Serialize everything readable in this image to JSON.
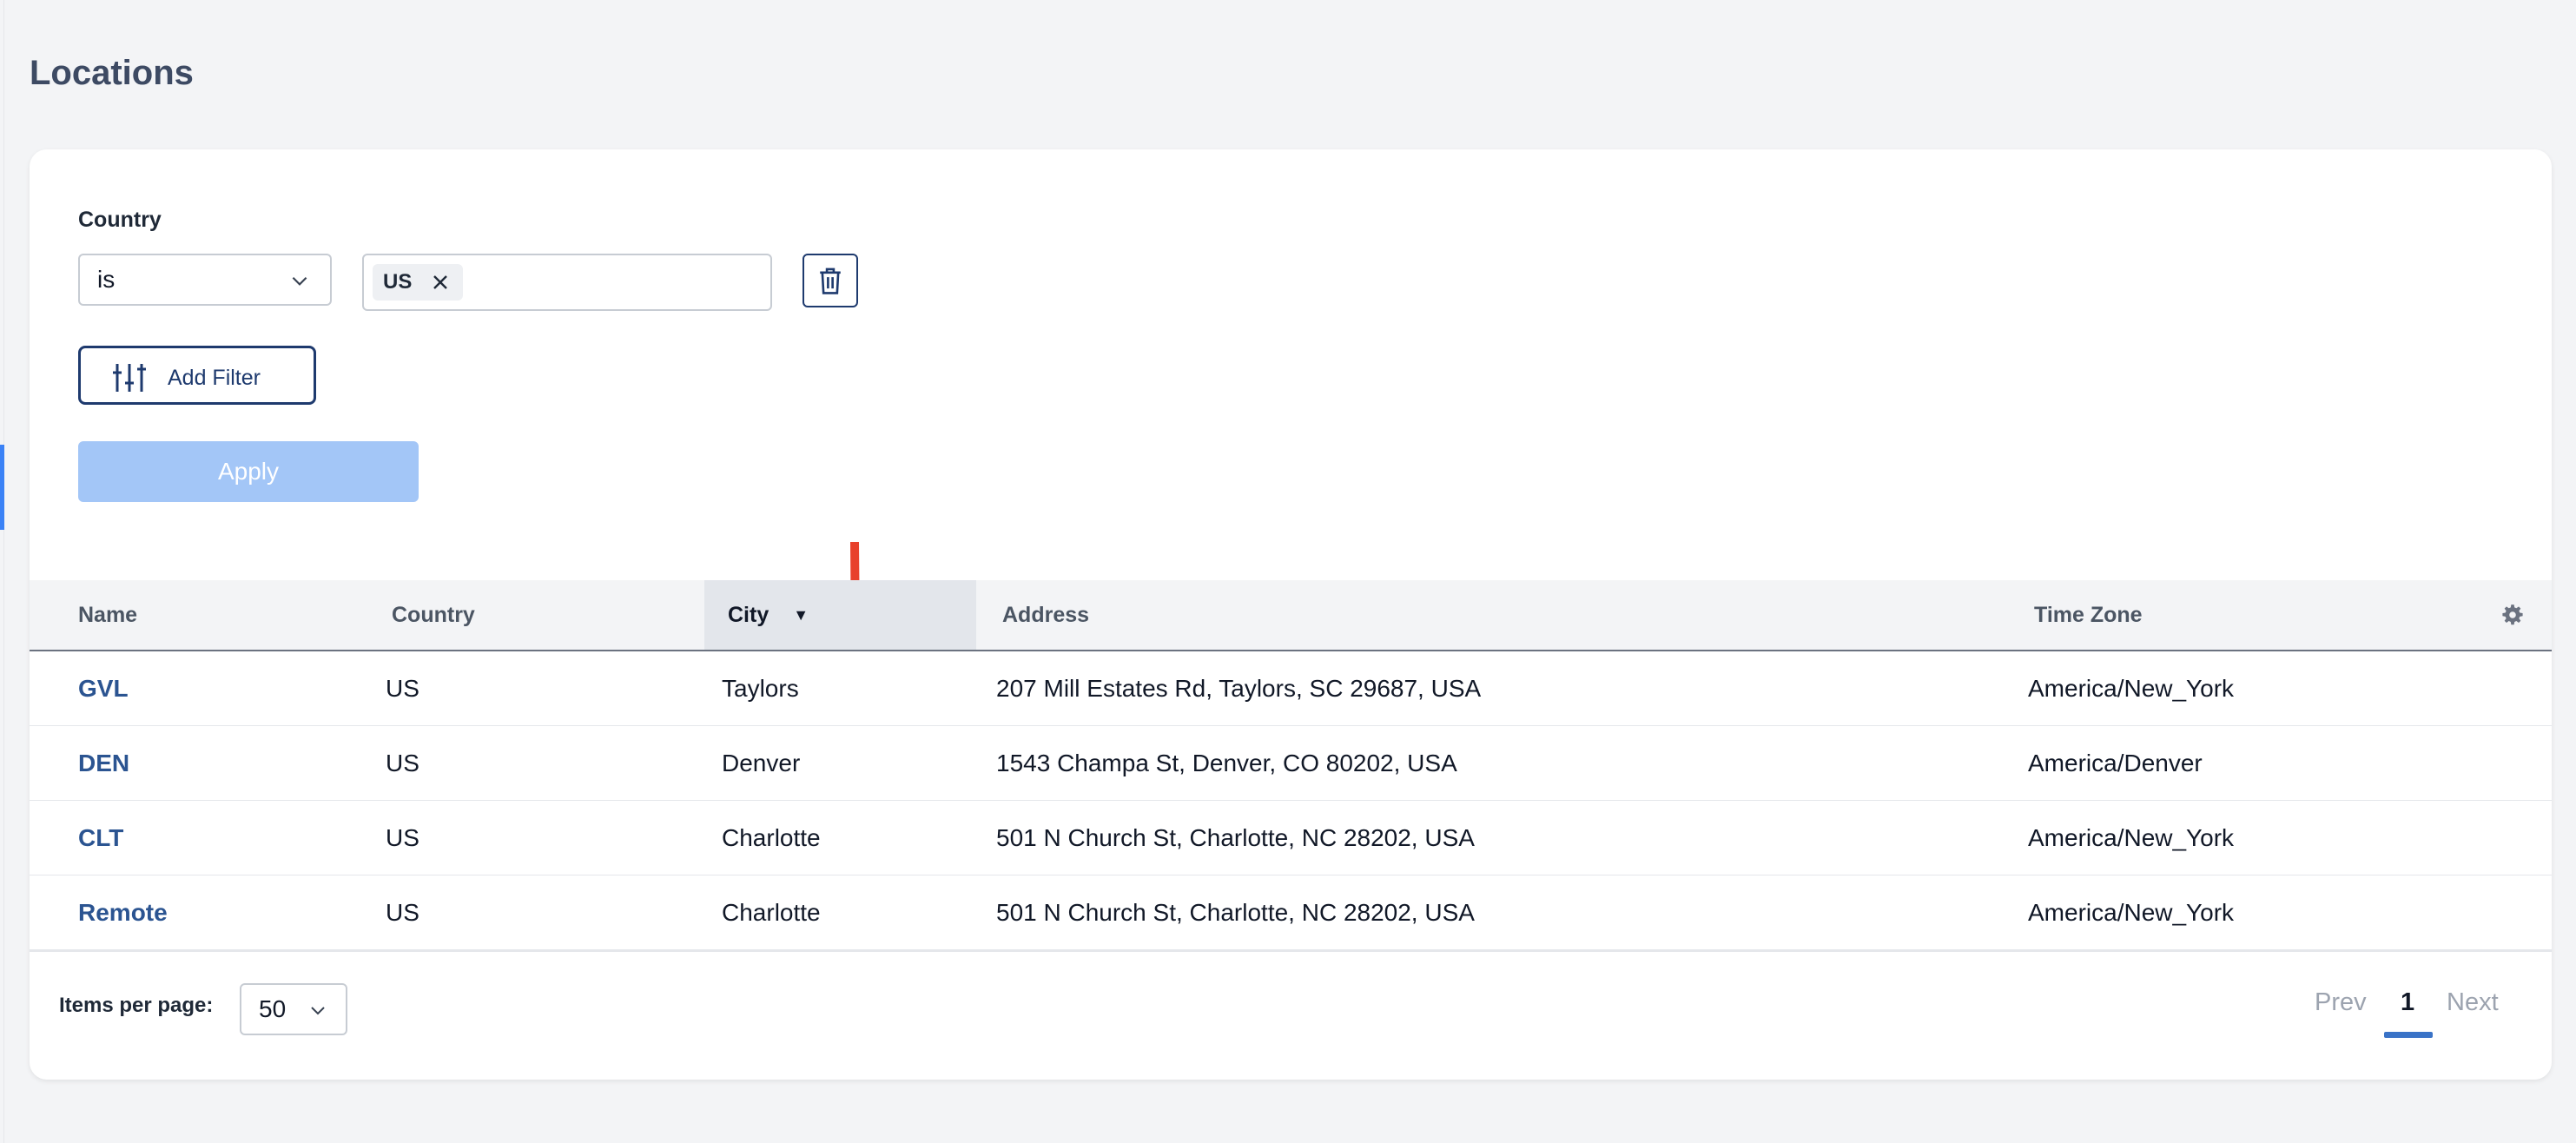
{
  "page": {
    "title": "Locations"
  },
  "filter": {
    "field_label": "Country",
    "operator": "is",
    "chips": [
      "US"
    ],
    "add_filter_label": "Add Filter",
    "apply_label": "Apply"
  },
  "table": {
    "columns": [
      "Name",
      "Country",
      "City",
      "Address",
      "Time Zone"
    ],
    "sorted_column": "City",
    "sort_direction": "descending",
    "rows": [
      {
        "name": "GVL",
        "country": "US",
        "city": "Taylors",
        "address": "207 Mill Estates Rd, Taylors, SC 29687, USA",
        "time_zone": "America/New_York"
      },
      {
        "name": "DEN",
        "country": "US",
        "city": "Denver",
        "address": "1543 Champa St, Denver, CO 80202, USA",
        "time_zone": "America/Denver"
      },
      {
        "name": "CLT",
        "country": "US",
        "city": "Charlotte",
        "address": "501 N Church St, Charlotte, NC 28202, USA",
        "time_zone": "America/New_York"
      },
      {
        "name": "Remote",
        "country": "US",
        "city": "Charlotte",
        "address": "501 N Church St, Charlotte, NC 28202, USA",
        "time_zone": "America/New_York"
      }
    ]
  },
  "pagination": {
    "items_per_page_label": "Items per page:",
    "items_per_page": "50",
    "prev_label": "Prev",
    "current_page": "1",
    "next_label": "Next"
  },
  "colors": {
    "accent": "#3a73c7",
    "link": "#2b5491",
    "apply_disabled": "#a3c6f7",
    "annotation_arrow": "#e8412c"
  }
}
